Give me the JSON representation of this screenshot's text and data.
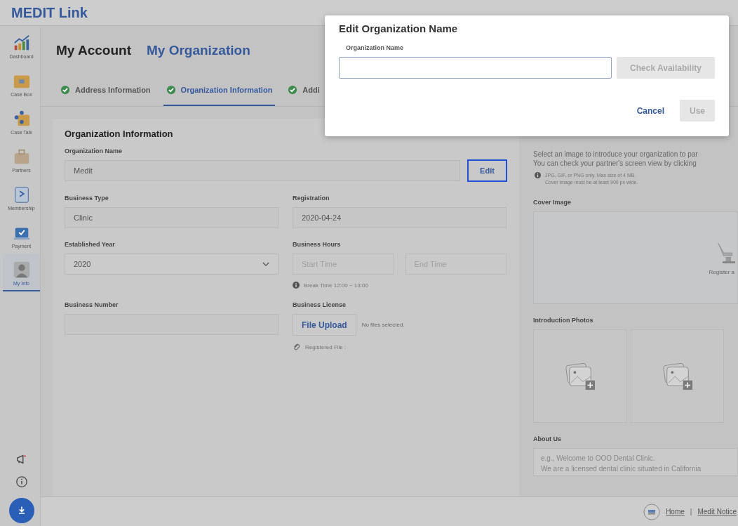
{
  "app_title": "MEDIT Link",
  "sidebar": {
    "items": [
      {
        "label": "Dashboard",
        "selected": false
      },
      {
        "label": "Case Box",
        "selected": false
      },
      {
        "label": "Case Talk",
        "selected": false
      },
      {
        "label": "Partners",
        "selected": false
      },
      {
        "label": "Membership",
        "selected": false
      },
      {
        "label": "Payment",
        "selected": false
      },
      {
        "label": "My Info",
        "selected": true
      }
    ]
  },
  "page_tabs": [
    {
      "label": "My Account",
      "selected": false
    },
    {
      "label": "My Organization",
      "selected": true
    }
  ],
  "steps": [
    {
      "label": "Address Information",
      "selected": false,
      "done": true
    },
    {
      "label": "Organization Information",
      "selected": true,
      "done": true
    },
    {
      "label": "Addi",
      "selected": false,
      "done": true
    }
  ],
  "organization": {
    "title": "Organization Information",
    "org_name": {
      "label": "Organization Name",
      "value": "Medit",
      "action": "Edit"
    },
    "business_type": {
      "label": "Business Type",
      "value": "Clinic"
    },
    "registration": {
      "label": "Registration",
      "value": "2020-04-24"
    },
    "established_year": {
      "label": "Established Year",
      "value": "2020"
    },
    "business_hours": {
      "label": "Business Hours",
      "start_placeholder": "Start Time",
      "end_placeholder": "End Time",
      "note": "Break Time 12:00 ~ 13:00"
    },
    "business_number": {
      "label": "Business Number"
    },
    "business_license": {
      "label": "Business License",
      "button": "File Upload",
      "status": "No files selected.",
      "registered": "Registered File :"
    }
  },
  "about": {
    "intro": [
      "Select an image to introduce your organization to par",
      "You can check your partner's screen view by clicking"
    ],
    "notes": [
      "JPG, GIF, or PNG only. Max size of 4 MB.",
      "Cover image must be at least 900 px wide."
    ],
    "cover_label": "Cover Image",
    "cover_hint": "Register a",
    "photos_label": "Introduction Photos",
    "photo_slots": [
      {
        "kind": "add"
      },
      {
        "kind": "add"
      }
    ],
    "about_label": "About Us",
    "about_placeholder": [
      "e.g., Welcome to OOO Dental Clinic.",
      "We are a licensed dental clinic situated in California"
    ]
  },
  "footer": {
    "links": [
      "Home",
      "Medit Notice"
    ],
    "separator": "|"
  },
  "dialog": {
    "title": "Edit Organization Name",
    "field_label": "Organization Name",
    "check_button": "Check Availability",
    "check_disabled": true,
    "cancel": "Cancel",
    "use": "Use",
    "use_disabled": true
  }
}
